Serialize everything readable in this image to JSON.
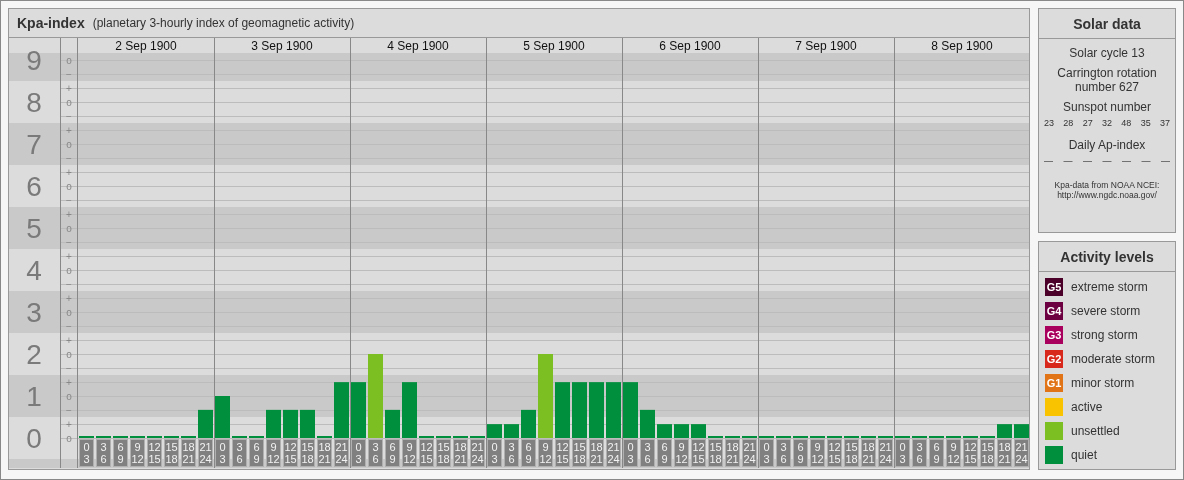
{
  "kpa": {
    "title": "Kpa-index",
    "subtitle": "(planetary 3-hourly index of geomagnetic activity)",
    "days": [
      "2 Sep 1900",
      "3 Sep 1900",
      "4 Sep 1900",
      "5 Sep 1900",
      "6 Sep 1900",
      "7 Sep 1900",
      "8 Sep 1900"
    ],
    "scale_marks": [
      "o",
      "−",
      "+",
      "o",
      "−",
      "+",
      "o",
      "−",
      "+",
      "o",
      "−",
      "+",
      "o",
      "−",
      "+",
      "o",
      "−",
      "+",
      "o",
      "−",
      "+",
      "o",
      "−",
      "+",
      "o",
      "−",
      "+",
      "o"
    ],
    "chart_data": {
      "type": "bar",
      "grid": true,
      "categories": [
        "0 3",
        "3 6",
        "6 9",
        "9 12",
        "12 15",
        "15 18",
        "18 21",
        "21 24",
        "0 3",
        "3 6",
        "6 9",
        "9 12",
        "12 15",
        "15 18",
        "18 21",
        "21 24",
        "0 3",
        "3 6",
        "6 9",
        "9 12",
        "12 15",
        "15 18",
        "18 21",
        "21 24",
        "0 3",
        "3 6",
        "6 9",
        "9 12",
        "12 15",
        "15 18",
        "18 21",
        "21 24",
        "0 3",
        "3 6",
        "6 9",
        "9 12",
        "12 15",
        "15 18",
        "18 21",
        "21 24",
        "0 3",
        "3 6",
        "6 9",
        "9 12",
        "12 15",
        "15 18",
        "18 21",
        "21 24",
        "0 3",
        "3 6",
        "6 9",
        "9 12",
        "12 15",
        "15 18",
        "18 21",
        "21 24"
      ],
      "ylim": [
        0,
        9
      ],
      "yticks": [
        {
          "value": 9,
          "label": "9"
        },
        {
          "value": 8,
          "label": "8"
        },
        {
          "value": 7,
          "label": "7"
        },
        {
          "value": 6,
          "label": "6"
        },
        {
          "value": 5,
          "label": "5"
        },
        {
          "value": 4,
          "label": "4"
        },
        {
          "value": 3,
          "label": "3"
        },
        {
          "value": 2,
          "label": "2"
        },
        {
          "value": 1,
          "label": "1"
        },
        {
          "value": 0,
          "label": "0"
        }
      ],
      "series": [
        {
          "color": "#008f3c",
          "values": [
            0,
            0,
            0,
            0,
            0,
            0,
            0,
            0.67,
            1,
            0,
            0,
            0.67,
            0.67,
            0.67,
            0,
            1.33,
            1.33,
            null,
            0.67,
            1.33,
            0,
            0,
            0,
            0,
            0.33,
            0.33,
            0.67,
            null,
            1.33,
            1.33,
            1.33,
            1.33,
            1.33,
            0.67,
            0.33,
            0.33,
            0.33,
            0,
            0,
            0,
            0,
            0,
            0,
            0,
            0,
            0,
            0,
            0,
            0,
            0,
            0,
            0,
            0,
            0,
            0.33,
            0.33
          ]
        },
        {
          "color": "#7bbf23",
          "values": [
            null,
            null,
            null,
            null,
            null,
            null,
            null,
            null,
            null,
            null,
            null,
            null,
            null,
            null,
            null,
            null,
            null,
            2,
            null,
            null,
            null,
            null,
            null,
            null,
            null,
            null,
            null,
            2,
            null,
            null,
            null,
            null,
            null,
            null,
            null,
            null,
            null,
            null,
            null,
            null,
            null,
            null,
            null,
            null,
            null,
            null,
            null,
            null,
            null,
            null,
            null,
            null,
            null,
            null,
            null,
            null
          ]
        }
      ]
    }
  },
  "solar_data": {
    "title": "Solar data",
    "solar_cycle": "Solar cycle 13",
    "carrington": "Carrington rotation number 627",
    "sunspot_label": "Sunspot number",
    "sunspot_numbers": [
      "23",
      "28",
      "27",
      "32",
      "48",
      "35",
      "37"
    ],
    "ap_label": "Daily Ap-index",
    "ap_values": [
      "—",
      "—",
      "—",
      "—",
      "—",
      "—",
      "—"
    ],
    "source": "Kpa-data from NOAA NCEI:",
    "source_url": "http://www.ngdc.noaa.gov/"
  },
  "activity_levels": {
    "title": "Activity levels",
    "items": [
      {
        "badge": "G5",
        "label": "extreme storm",
        "color": "#4a0028"
      },
      {
        "badge": "G4",
        "label": "severe storm",
        "color": "#6c0040"
      },
      {
        "badge": "G3",
        "label": "strong storm",
        "color": "#a8005c"
      },
      {
        "badge": "G2",
        "label": "moderate storm",
        "color": "#d8281c"
      },
      {
        "badge": "G1",
        "label": "minor storm",
        "color": "#e27418"
      },
      {
        "label": "active",
        "color": "#f9c300"
      },
      {
        "label": "unsettled",
        "color": "#7bbf23"
      },
      {
        "label": "quiet",
        "color": "#008f3c"
      }
    ]
  }
}
